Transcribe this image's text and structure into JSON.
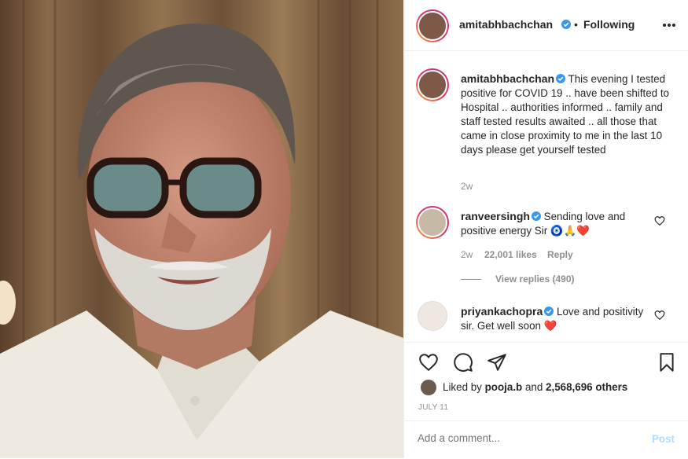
{
  "post": {
    "username": "amitabhbachchan",
    "follow_status": "Following",
    "more_icon": "more-options-icon",
    "caption": "This evening I tested positive for COVID 19 .. have been shifted to Hospital .. authorities informed .. family and staff tested results awaited .. all those that came in close proximity to me in the last 10 days please get yourself tested",
    "caption_time": "2w"
  },
  "comments": [
    {
      "username": "ranveersingh",
      "text": "Sending love and positive energy Sir",
      "emoji": "🧿🙏❤️",
      "time": "2w",
      "likes": "22,001 likes",
      "reply_label": "Reply",
      "view_replies": "View replies (490)"
    },
    {
      "username": "priyankachopra",
      "text": "Love and positivity sir. Get well soon",
      "emoji": "❤️"
    }
  ],
  "likes": {
    "prefix": "Liked by",
    "user": "pooja.b",
    "joiner": "and",
    "count": "2,568,696 others"
  },
  "date": "JULY 11",
  "comment_box": {
    "placeholder": "Add a comment...",
    "post_label": "Post"
  },
  "colors": {
    "verified": "#3897f0",
    "heart": "#ed4956",
    "post_button": "#b3dbff"
  }
}
